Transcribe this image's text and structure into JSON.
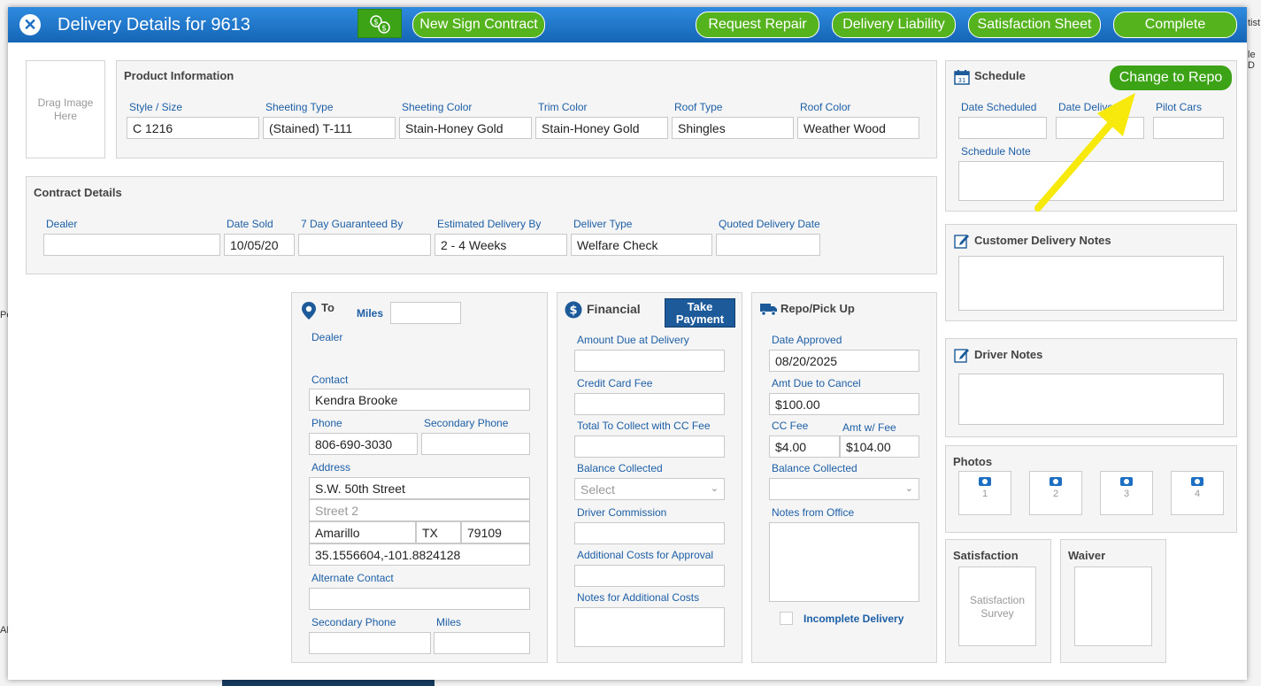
{
  "background": {
    "right_text": [
      "tist",
      "le D"
    ],
    "left_text": [
      "Pe",
      "AM"
    ]
  },
  "header": {
    "title": "Delivery Details for 9613",
    "buttons": {
      "new_sign_contract": "New Sign Contract",
      "request_repair": "Request Repair",
      "delivery_liability": "Delivery Liability",
      "satisfaction_sheet": "Satisfaction Sheet",
      "complete": "Complete"
    }
  },
  "drag_image": "Drag Image Here",
  "product": {
    "title": "Product Information",
    "style_size": {
      "label": "Style / Size",
      "value": "C 1216"
    },
    "sheeting_type": {
      "label": "Sheeting Type",
      "value": "(Stained) T-111"
    },
    "sheeting_color": {
      "label": "Sheeting Color",
      "value": "Stain-Honey Gold"
    },
    "trim_color": {
      "label": "Trim Color",
      "value": "Stain-Honey Gold"
    },
    "roof_type": {
      "label": "Roof Type",
      "value": "Shingles"
    },
    "roof_color": {
      "label": "Roof Color",
      "value": "Weather Wood"
    }
  },
  "contract": {
    "title": "Contract Details",
    "dealer": {
      "label": "Dealer",
      "value": ""
    },
    "date_sold": {
      "label": "Date Sold",
      "value": "10/05/20"
    },
    "guaranteed_by": {
      "label": "7 Day Guaranteed By",
      "value": ""
    },
    "estimated_delivery": {
      "label": "Estimated Delivery By",
      "value": "2 - 4 Weeks"
    },
    "deliver_type": {
      "label": "Deliver Type",
      "value": "Welfare Check"
    },
    "quoted_delivery": {
      "label": "Quoted Delivery Date",
      "value": ""
    }
  },
  "to": {
    "title": "To",
    "miles_label": "Miles",
    "miles_value": "",
    "dealer_label": "Dealer",
    "contact_label": "Contact",
    "contact_value": "Kendra  Brooke",
    "phone_label": "Phone",
    "phone_value": "806-690-3030",
    "secondary_phone_label": "Secondary Phone",
    "secondary_phone_value": "",
    "address_label": "Address",
    "street1": "S.W. 50th Street",
    "street2_placeholder": "Street 2",
    "city": "Amarillo",
    "state": "TX",
    "zip": "79109",
    "coords": "35.1556604,-101.8824128",
    "alt_contact_label": "Alternate Contact",
    "alt_secondary_phone_label": "Secondary Phone",
    "alt_miles_label": "Miles"
  },
  "financial": {
    "title": "Financial",
    "take_payment": "Take Payment",
    "amount_due_label": "Amount Due at Delivery",
    "cc_fee_label": "Credit Card Fee",
    "total_cc_label": "Total To Collect with CC Fee",
    "balance_collected_label": "Balance Collected",
    "balance_collected_value": "Select",
    "driver_commission_label": "Driver Commission",
    "additional_costs_label": "Additional Costs for Approval",
    "notes_additional_label": "Notes for Additional Costs"
  },
  "repo": {
    "title": "Repo/Pick Up",
    "date_approved_label": "Date Approved",
    "date_approved_value": "08/20/2025",
    "amt_due_cancel_label": "Amt Due to Cancel",
    "amt_due_cancel_value": "$100.00",
    "cc_fee_label": "CC Fee",
    "cc_fee_value": "$4.00",
    "amt_w_fee_label": "Amt w/ Fee",
    "amt_w_fee_value": "$104.00",
    "balance_collected_label": "Balance Collected",
    "notes_office_label": "Notes from Office",
    "incomplete_label": "Incomplete Delivery"
  },
  "schedule": {
    "title": "Schedule",
    "change_repo": "Change to Repo",
    "date_scheduled_label": "Date Scheduled",
    "date_delivered_label": "Date Delivered",
    "pilot_cars_label": "Pilot Cars",
    "schedule_note_label": "Schedule Note"
  },
  "customer_notes": {
    "title": "Customer Delivery Notes"
  },
  "driver_notes": {
    "title": "Driver Notes"
  },
  "photos": {
    "title": "Photos",
    "items": [
      "1",
      "2",
      "3",
      "4"
    ]
  },
  "satisfaction": {
    "title": "Satisfaction",
    "survey": "Satisfaction Survey"
  },
  "waiver": {
    "title": "Waiver"
  },
  "colors": {
    "header": "#1c6fc2",
    "green": "#55b31e",
    "label": "#1d5fa6",
    "arrow": "#f7e90b"
  }
}
